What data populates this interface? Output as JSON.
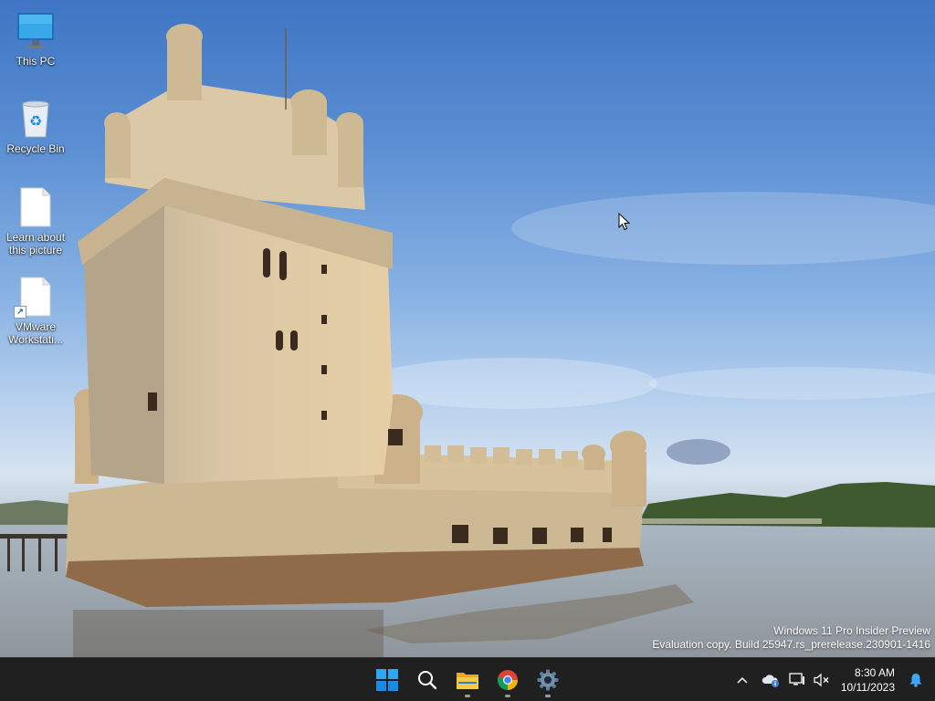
{
  "desktop": {
    "icons": [
      {
        "label": "This PC",
        "icon": "monitor-icon"
      },
      {
        "label": "Recycle Bin",
        "icon": "recycle-bin-icon"
      },
      {
        "label": "Learn about\nthis picture",
        "icon": "file-icon"
      },
      {
        "label": "VMware\nWorkstati...",
        "icon": "shortcut-file-icon"
      }
    ]
  },
  "watermark": {
    "line1": "Windows 11 Pro Insider Preview",
    "line2": "Evaluation copy. Build 25947.rs_prerelease.230901-1416"
  },
  "taskbar": {
    "apps": [
      {
        "name": "Start",
        "icon": "windows-logo-icon"
      },
      {
        "name": "Search",
        "icon": "search-icon"
      },
      {
        "name": "File Explorer",
        "icon": "folder-icon"
      },
      {
        "name": "Google Chrome",
        "icon": "chrome-icon"
      },
      {
        "name": "Settings",
        "icon": "gear-icon"
      }
    ],
    "tray": {
      "overflow_icon": "chevron-up-icon",
      "icons": [
        "onedrive-icon",
        "network-icon",
        "volume-muted-icon"
      ],
      "time": "8:30 AM",
      "date": "10/11/2023",
      "notification_icon": "bell-icon"
    }
  },
  "colors": {
    "taskbar": "#202020",
    "accent": "#1e90ff",
    "sky_top": "#3f75c4",
    "water": "#8a949c"
  }
}
